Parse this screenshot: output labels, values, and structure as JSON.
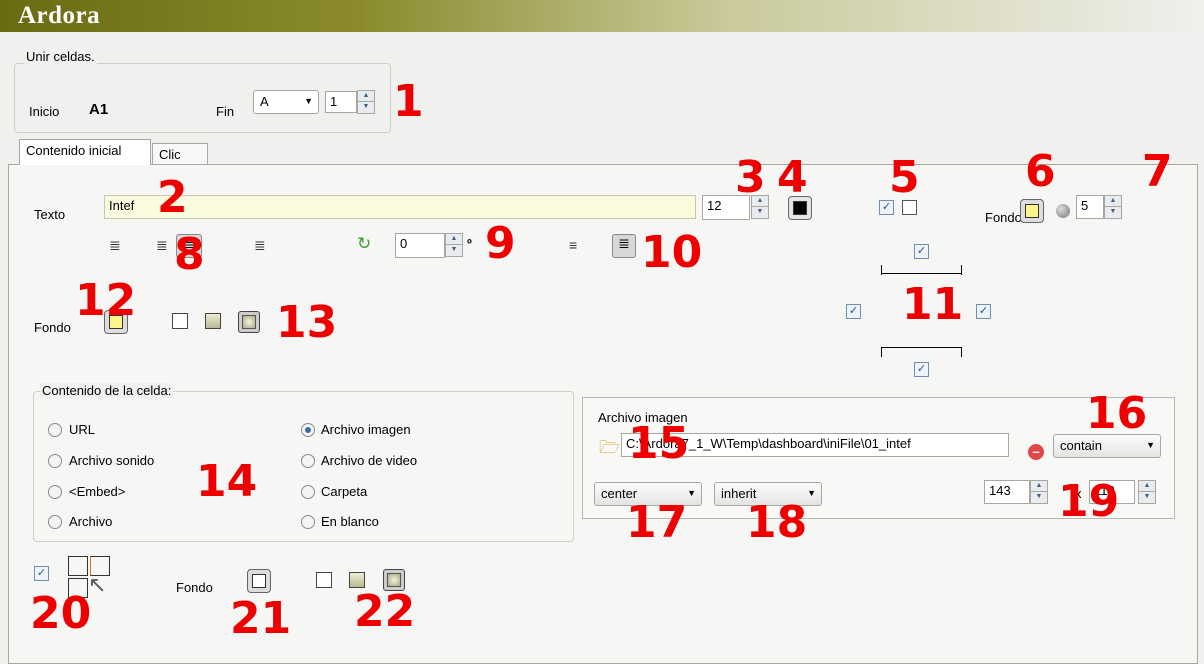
{
  "app": {
    "title": "Ardora"
  },
  "merge": {
    "legend": "Unir celdas.",
    "start_label": "Inicio",
    "start_value": "A1",
    "end_label": "Fin",
    "end_col": "A",
    "end_row": "1"
  },
  "tabs": [
    {
      "label": "Contenido inicial",
      "active": true
    },
    {
      "label": "Clic",
      "active": false
    }
  ],
  "text": {
    "label": "Texto",
    "value": "Intef",
    "font_size": "12",
    "rotation": "0",
    "degree_symbol": "º",
    "bg_label": "Fondo",
    "radius": "5"
  },
  "cell_bg": {
    "label": "Fondo"
  },
  "content": {
    "legend": "Contenido de la celda:",
    "options": [
      {
        "label": "URL",
        "selected": false
      },
      {
        "label": "Archivo imagen",
        "selected": true
      },
      {
        "label": "Archivo sonido",
        "selected": false
      },
      {
        "label": "Archivo de video",
        "selected": false
      },
      {
        "label": "<Embed>",
        "selected": false
      },
      {
        "label": "Carpeta",
        "selected": false
      },
      {
        "label": "Archivo",
        "selected": false
      },
      {
        "label": "En blanco",
        "selected": false
      }
    ]
  },
  "image": {
    "label": "Archivo imagen",
    "path": "C:\\Ardora7_1_W\\Temp\\dashboard\\iniFile\\01_intef",
    "size_mode": "contain",
    "position": "center",
    "repeat": "inherit",
    "width": "143",
    "height": "112",
    "times": "x"
  },
  "footer": {
    "bg_label": "Fondo"
  },
  "annotations": [
    "1",
    "2",
    "3",
    "4",
    "5",
    "6",
    "7",
    "8",
    "9",
    "10",
    "11",
    "12",
    "13",
    "14",
    "15",
    "16",
    "17",
    "18",
    "19",
    "20",
    "21",
    "22"
  ],
  "colors": {
    "accent_red": "#ee0000",
    "title_olive": "#6a6a12",
    "text_bg": "#fafadf"
  }
}
